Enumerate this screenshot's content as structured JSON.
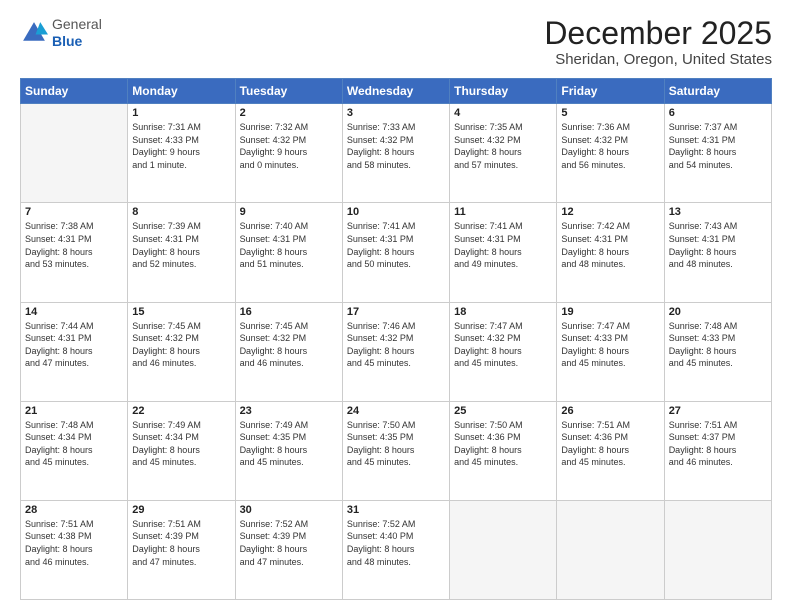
{
  "logo": {
    "general": "General",
    "blue": "Blue"
  },
  "header": {
    "title": "December 2025",
    "subtitle": "Sheridan, Oregon, United States"
  },
  "weekdays": [
    "Sunday",
    "Monday",
    "Tuesday",
    "Wednesday",
    "Thursday",
    "Friday",
    "Saturday"
  ],
  "weeks": [
    [
      {
        "day": "",
        "info": ""
      },
      {
        "day": "1",
        "info": "Sunrise: 7:31 AM\nSunset: 4:33 PM\nDaylight: 9 hours\nand 1 minute."
      },
      {
        "day": "2",
        "info": "Sunrise: 7:32 AM\nSunset: 4:32 PM\nDaylight: 9 hours\nand 0 minutes."
      },
      {
        "day": "3",
        "info": "Sunrise: 7:33 AM\nSunset: 4:32 PM\nDaylight: 8 hours\nand 58 minutes."
      },
      {
        "day": "4",
        "info": "Sunrise: 7:35 AM\nSunset: 4:32 PM\nDaylight: 8 hours\nand 57 minutes."
      },
      {
        "day": "5",
        "info": "Sunrise: 7:36 AM\nSunset: 4:32 PM\nDaylight: 8 hours\nand 56 minutes."
      },
      {
        "day": "6",
        "info": "Sunrise: 7:37 AM\nSunset: 4:31 PM\nDaylight: 8 hours\nand 54 minutes."
      }
    ],
    [
      {
        "day": "7",
        "info": "Sunrise: 7:38 AM\nSunset: 4:31 PM\nDaylight: 8 hours\nand 53 minutes."
      },
      {
        "day": "8",
        "info": "Sunrise: 7:39 AM\nSunset: 4:31 PM\nDaylight: 8 hours\nand 52 minutes."
      },
      {
        "day": "9",
        "info": "Sunrise: 7:40 AM\nSunset: 4:31 PM\nDaylight: 8 hours\nand 51 minutes."
      },
      {
        "day": "10",
        "info": "Sunrise: 7:41 AM\nSunset: 4:31 PM\nDaylight: 8 hours\nand 50 minutes."
      },
      {
        "day": "11",
        "info": "Sunrise: 7:41 AM\nSunset: 4:31 PM\nDaylight: 8 hours\nand 49 minutes."
      },
      {
        "day": "12",
        "info": "Sunrise: 7:42 AM\nSunset: 4:31 PM\nDaylight: 8 hours\nand 48 minutes."
      },
      {
        "day": "13",
        "info": "Sunrise: 7:43 AM\nSunset: 4:31 PM\nDaylight: 8 hours\nand 48 minutes."
      }
    ],
    [
      {
        "day": "14",
        "info": "Sunrise: 7:44 AM\nSunset: 4:31 PM\nDaylight: 8 hours\nand 47 minutes."
      },
      {
        "day": "15",
        "info": "Sunrise: 7:45 AM\nSunset: 4:32 PM\nDaylight: 8 hours\nand 46 minutes."
      },
      {
        "day": "16",
        "info": "Sunrise: 7:45 AM\nSunset: 4:32 PM\nDaylight: 8 hours\nand 46 minutes."
      },
      {
        "day": "17",
        "info": "Sunrise: 7:46 AM\nSunset: 4:32 PM\nDaylight: 8 hours\nand 45 minutes."
      },
      {
        "day": "18",
        "info": "Sunrise: 7:47 AM\nSunset: 4:32 PM\nDaylight: 8 hours\nand 45 minutes."
      },
      {
        "day": "19",
        "info": "Sunrise: 7:47 AM\nSunset: 4:33 PM\nDaylight: 8 hours\nand 45 minutes."
      },
      {
        "day": "20",
        "info": "Sunrise: 7:48 AM\nSunset: 4:33 PM\nDaylight: 8 hours\nand 45 minutes."
      }
    ],
    [
      {
        "day": "21",
        "info": "Sunrise: 7:48 AM\nSunset: 4:34 PM\nDaylight: 8 hours\nand 45 minutes."
      },
      {
        "day": "22",
        "info": "Sunrise: 7:49 AM\nSunset: 4:34 PM\nDaylight: 8 hours\nand 45 minutes."
      },
      {
        "day": "23",
        "info": "Sunrise: 7:49 AM\nSunset: 4:35 PM\nDaylight: 8 hours\nand 45 minutes."
      },
      {
        "day": "24",
        "info": "Sunrise: 7:50 AM\nSunset: 4:35 PM\nDaylight: 8 hours\nand 45 minutes."
      },
      {
        "day": "25",
        "info": "Sunrise: 7:50 AM\nSunset: 4:36 PM\nDaylight: 8 hours\nand 45 minutes."
      },
      {
        "day": "26",
        "info": "Sunrise: 7:51 AM\nSunset: 4:36 PM\nDaylight: 8 hours\nand 45 minutes."
      },
      {
        "day": "27",
        "info": "Sunrise: 7:51 AM\nSunset: 4:37 PM\nDaylight: 8 hours\nand 46 minutes."
      }
    ],
    [
      {
        "day": "28",
        "info": "Sunrise: 7:51 AM\nSunset: 4:38 PM\nDaylight: 8 hours\nand 46 minutes."
      },
      {
        "day": "29",
        "info": "Sunrise: 7:51 AM\nSunset: 4:39 PM\nDaylight: 8 hours\nand 47 minutes."
      },
      {
        "day": "30",
        "info": "Sunrise: 7:52 AM\nSunset: 4:39 PM\nDaylight: 8 hours\nand 47 minutes."
      },
      {
        "day": "31",
        "info": "Sunrise: 7:52 AM\nSunset: 4:40 PM\nDaylight: 8 hours\nand 48 minutes."
      },
      {
        "day": "",
        "info": ""
      },
      {
        "day": "",
        "info": ""
      },
      {
        "day": "",
        "info": ""
      }
    ]
  ]
}
